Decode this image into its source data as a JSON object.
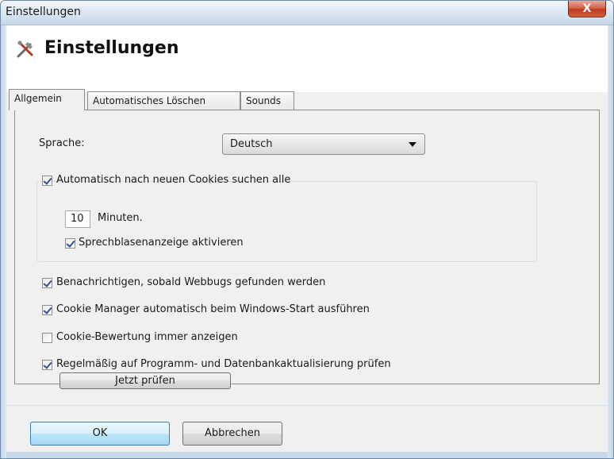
{
  "window": {
    "title": "Einstellungen",
    "close_glyph": "X"
  },
  "header": {
    "icon": "tools-icon",
    "title": "Einstellungen"
  },
  "tabs": [
    {
      "label": "Allgemein",
      "active": true
    },
    {
      "label": "Automatisches Löschen",
      "active": false
    },
    {
      "label": "Sounds",
      "active": false
    }
  ],
  "general": {
    "language_label": "Sprache:",
    "language_value": "Deutsch",
    "auto_search_label": "Automatisch nach neuen Cookies suchen alle",
    "auto_search_checked": true,
    "interval_value": "10",
    "minutes_label": "Minuten.",
    "balloon_label": "Sprechblasenanzeige aktivieren",
    "balloon_checked": true,
    "notify_webbugs_label": "Benachrichtigen, sobald Webbugs gefunden werden",
    "notify_webbugs_checked": true,
    "autostart_label": "Cookie Manager automatisch beim Windows-Start ausführen",
    "autostart_checked": true,
    "rating_label": "Cookie-Bewertung immer anzeigen",
    "rating_checked": false,
    "update_check_label": "Regelmäßig auf Programm- und Datenbankaktualisierung prüfen",
    "update_check_checked": true,
    "check_now_button": "Jetzt prüfen"
  },
  "footer": {
    "ok_button": "OK",
    "cancel_button": "Abbrechen"
  }
}
